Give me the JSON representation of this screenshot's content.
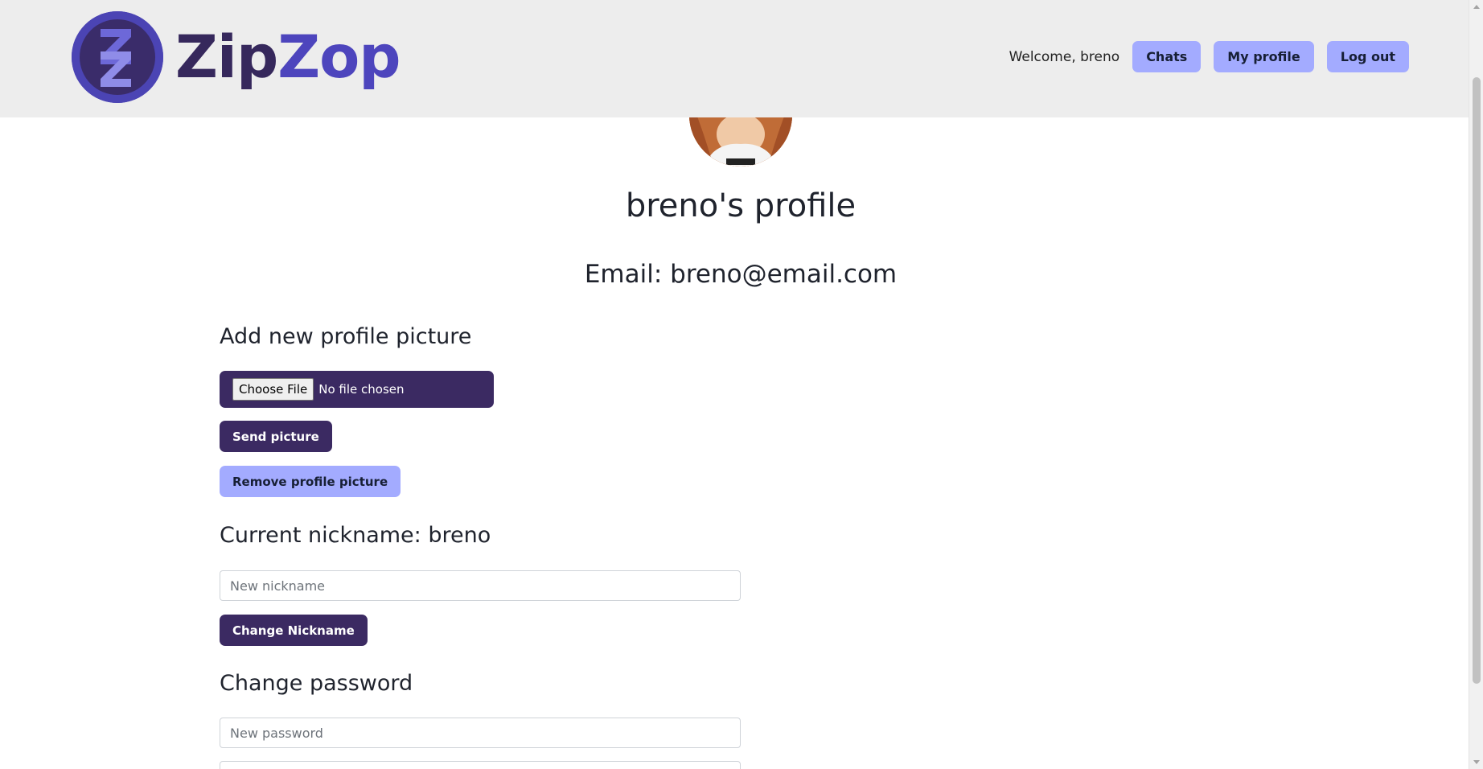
{
  "header": {
    "brand_part1": "Zip",
    "brand_part2": "Zop",
    "welcome": "Welcome, breno",
    "nav": {
      "chats": "Chats",
      "my_profile": "My profile",
      "log_out": "Log out"
    }
  },
  "profile": {
    "title": "breno's profile",
    "email": "Email: breno@email.com"
  },
  "picture": {
    "heading": "Add new profile picture",
    "choose_file": "Choose File",
    "file_status": "No file chosen",
    "send_button": "Send picture",
    "remove_button": "Remove profile picture"
  },
  "nickname": {
    "heading": "Current nickname: breno",
    "placeholder": "New nickname",
    "button": "Change Nickname"
  },
  "password": {
    "heading": "Change password",
    "placeholder": "New password"
  },
  "colors": {
    "primary_dark": "#3b2a62",
    "primary_light": "#a3abff",
    "brand_blue": "#4d45bd",
    "header_bg": "#ededed"
  }
}
